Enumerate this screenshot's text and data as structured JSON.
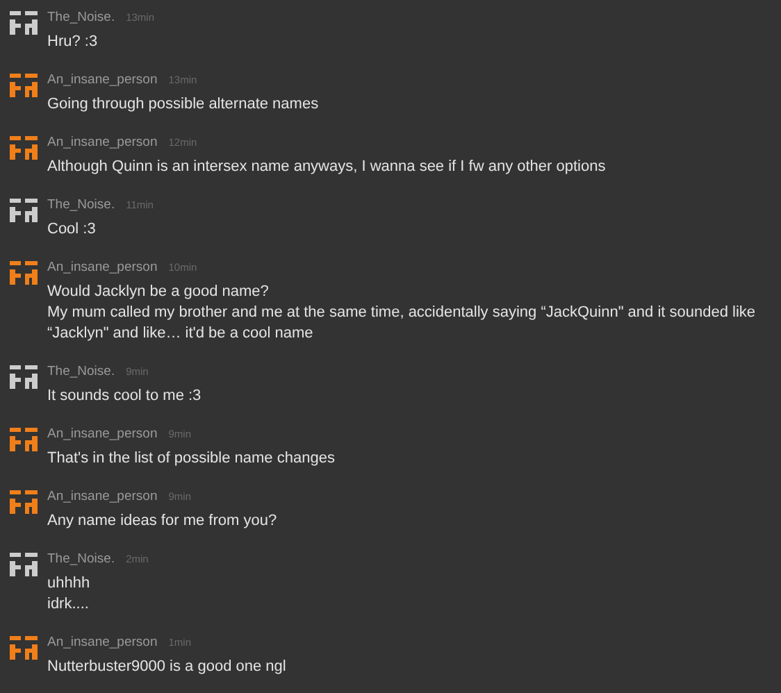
{
  "messages": [
    {
      "author": "The_Noise.",
      "time": "13min",
      "color": "#cccccc",
      "lines": [
        "Hru? :3"
      ]
    },
    {
      "author": "An_insane_person",
      "time": "13min",
      "color": "#f07f1a",
      "lines": [
        "Going through possible alternate names"
      ]
    },
    {
      "author": "An_insane_person",
      "time": "12min",
      "color": "#f07f1a",
      "lines": [
        "Although Quinn is an intersex name anyways, I wanna see if I fw any other options"
      ]
    },
    {
      "author": "The_Noise.",
      "time": "11min",
      "color": "#cccccc",
      "lines": [
        "Cool :3"
      ]
    },
    {
      "author": "An_insane_person",
      "time": "10min",
      "color": "#f07f1a",
      "lines": [
        "Would Jacklyn be a good name?",
        "My mum called my brother and me at the same time, accidentally saying “JackQuinn\" and it sounded like “Jacklyn\" and like… it'd be a cool name"
      ]
    },
    {
      "author": "The_Noise.",
      "time": "9min",
      "color": "#cccccc",
      "lines": [
        "It sounds cool to me :3"
      ]
    },
    {
      "author": "An_insane_person",
      "time": "9min",
      "color": "#f07f1a",
      "lines": [
        "That's in the list of possible name changes"
      ]
    },
    {
      "author": "An_insane_person",
      "time": "9min",
      "color": "#f07f1a",
      "lines": [
        "Any name ideas for me from you?"
      ]
    },
    {
      "author": "The_Noise.",
      "time": "2min",
      "color": "#cccccc",
      "lines": [
        "uhhhh",
        "idrk...."
      ]
    },
    {
      "author": "An_insane_person",
      "time": "1min",
      "color": "#f07f1a",
      "lines": [
        "Nutterbuster9000 is a good one ngl"
      ]
    }
  ]
}
